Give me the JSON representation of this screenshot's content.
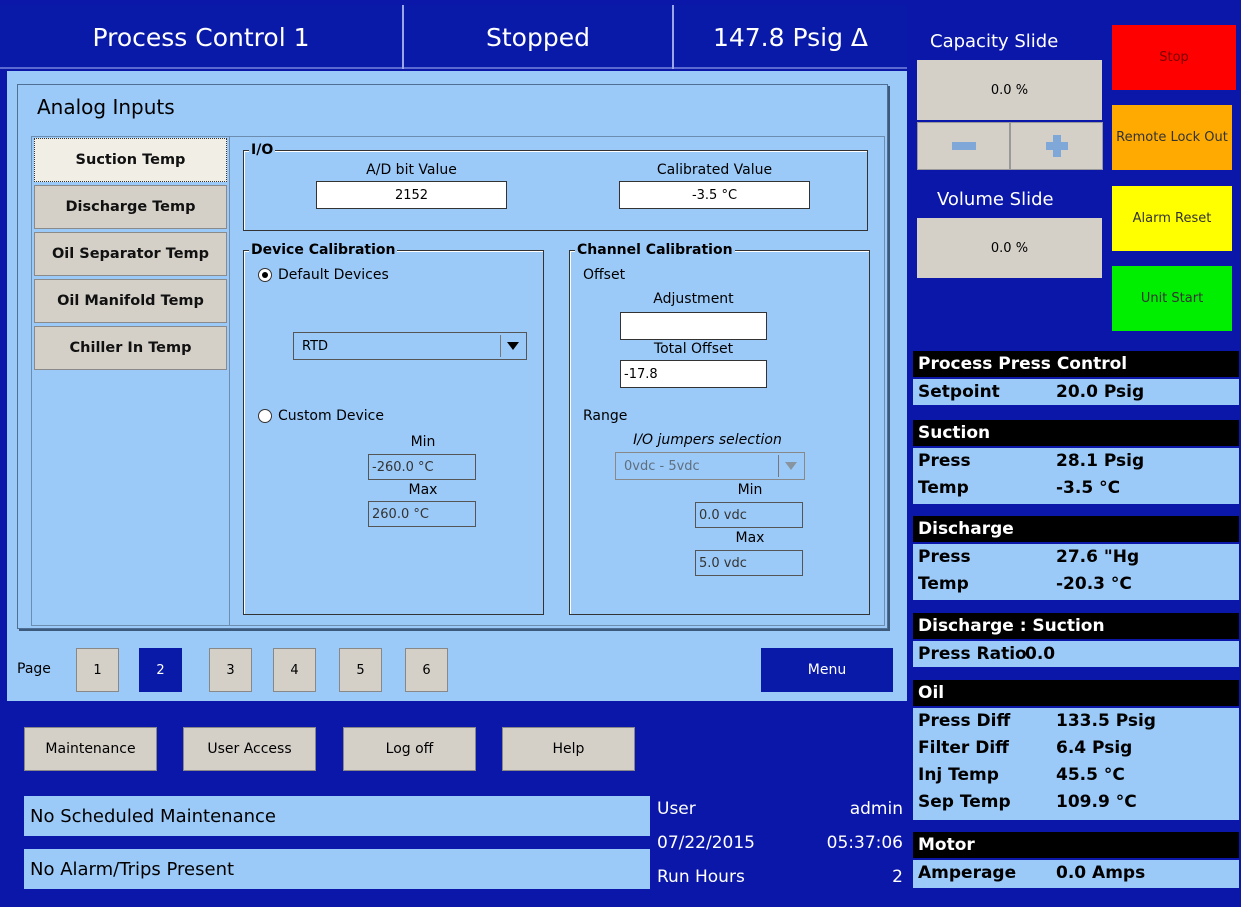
{
  "header": {
    "title": "Process Control 1",
    "state": "Stopped",
    "pressure": "147.8 Psig Δ"
  },
  "panel": {
    "title": "Analog Inputs",
    "tabs": [
      "Suction Temp",
      "Discharge Temp",
      "Oil Separator Temp",
      "Oil Manifold Temp",
      "Chiller In Temp"
    ]
  },
  "io": {
    "group_title": "I/O",
    "ad_label": "A/D bit Value",
    "ad_value": "2152",
    "cal_label": "Calibrated Value",
    "cal_value": "-3.5 °C"
  },
  "device_cal": {
    "group_title": "Device Calibration",
    "default_label": "Default Devices",
    "device_select": "RTD",
    "custom_label": "Custom Device",
    "min_label": "Min",
    "min_value": "-260.0 °C",
    "max_label": "Max",
    "max_value": "260.0 °C"
  },
  "channel_cal": {
    "group_title": "Channel Calibration",
    "offset_label": "Offset",
    "adjustment_label": "Adjustment",
    "adjustment_value": "",
    "total_offset_label": "Total Offset",
    "total_offset_value": "-17.8",
    "range_label": "Range",
    "jumpers_label": "I/O jumpers selection",
    "jumpers_value": "0vdc - 5vdc",
    "min_label": "Min",
    "min_value": "0.0 vdc",
    "max_label": "Max",
    "max_value": "5.0 vdc"
  },
  "pager": {
    "label": "Page",
    "pages": [
      "1",
      "2",
      "3",
      "4",
      "5",
      "6"
    ],
    "menu": "Menu"
  },
  "bottom": {
    "buttons": [
      "Maintenance",
      "User Access",
      "Log off",
      "Help"
    ],
    "maintenance_status": "No Scheduled Maintenance",
    "alarm_status": "No Alarm/Trips Present",
    "user_label": "User",
    "user_value": "admin",
    "date": "07/22/2015",
    "time": "05:37:06",
    "run_hours_label": "Run Hours",
    "run_hours_value": "2"
  },
  "side": {
    "capacity_title": "Capacity Slide",
    "capacity_value": "0.0 %",
    "volume_title": "Volume Slide",
    "volume_value": "0.0 %",
    "controls": {
      "stop": "Stop",
      "remote": "Remote Lock Out",
      "alarm_reset": "Alarm Reset",
      "unit_start": "Unit Start"
    },
    "ppc": {
      "title": "Process Press Control",
      "k1": "Setpoint",
      "v1": "20.0 Psig"
    },
    "suction": {
      "title": "Suction",
      "k1": "Press",
      "v1": "28.1 Psig",
      "k2": "Temp",
      "v2": "-3.5 °C"
    },
    "discharge": {
      "title": "Discharge",
      "k1": "Press",
      "v1": "27.6 \"Hg",
      "k2": "Temp",
      "v2": "-20.3 °C"
    },
    "ratio": {
      "title": "Discharge : Suction",
      "k1": "Press Ratio",
      "v1": "0.0"
    },
    "oil": {
      "title": "Oil",
      "k1": "Press Diff",
      "v1": "133.5 Psig",
      "k2": "Filter Diff",
      "v2": "6.4 Psig",
      "k3": "Inj Temp",
      "v3": "45.5 °C",
      "k4": "Sep Temp",
      "v4": "109.9 °C"
    },
    "motor": {
      "title": "Motor",
      "k1": "Amperage",
      "v1": "0.0 Amps"
    }
  },
  "colors": {
    "background": "#0a17a8",
    "panel": "#9ccaf8",
    "stop": "#ff0000",
    "remote": "#ffaa00",
    "alarm_reset": "#ffff00",
    "unit_start": "#00ee00"
  }
}
